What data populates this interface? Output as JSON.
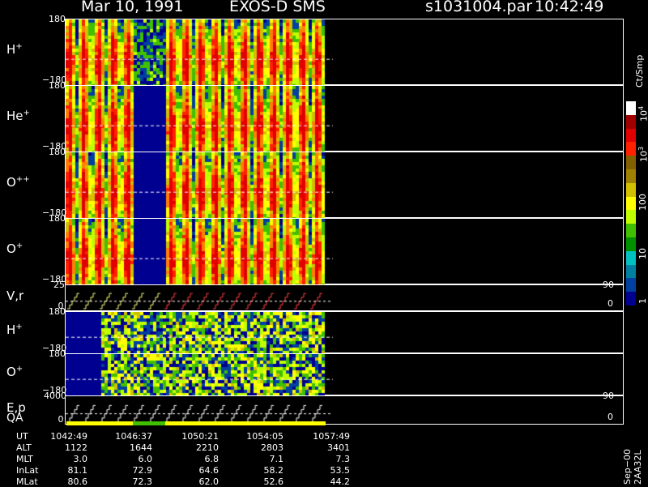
{
  "header": {
    "date": "Mar 10, 1991",
    "instrument": "EXOS-D SMS",
    "file": "s1031004.par",
    "time": "10:42:49"
  },
  "panels": [
    {
      "id": "h-plus-1",
      "label_base": "H",
      "label_sup": "+",
      "ytop": "180",
      "ybot": "−180"
    },
    {
      "id": "he-plus",
      "label_base": "He",
      "label_sup": "+",
      "ytop": "180",
      "ybot": "−180"
    },
    {
      "id": "o-plus-plus",
      "label_base": "O",
      "label_sup": "++",
      "ytop": "180",
      "ybot": "−180"
    },
    {
      "id": "o-plus-1",
      "label_base": "O",
      "label_sup": "+",
      "ytop": "180",
      "ybot": "−180"
    },
    {
      "id": "vr",
      "label_base": "V,r",
      "label_sup": "",
      "ytop": "25",
      "ybot": "0",
      "right_top": "90",
      "right_bot": "0"
    },
    {
      "id": "h-plus-2",
      "label_base": "H",
      "label_sup": "+",
      "ytop": "180",
      "ybot": "−180"
    },
    {
      "id": "o-plus-2",
      "label_base": "O",
      "label_sup": "+",
      "ytop": "180",
      "ybot": "−180"
    },
    {
      "id": "ep",
      "label_base": "E,p",
      "label_sup": "",
      "ytop": "4000",
      "ybot": "0",
      "right_top": "90",
      "right_bot": "0"
    }
  ],
  "qa_label": "QA",
  "colorbar": {
    "unit": "Ct/Smp",
    "ticks": [
      {
        "base": "10",
        "sup": "4"
      },
      {
        "base": "10",
        "sup": "3"
      },
      {
        "base": "100",
        "sup": ""
      },
      {
        "base": "10",
        "sup": ""
      },
      {
        "base": "1",
        "sup": ""
      }
    ],
    "colors": [
      "#ffffff",
      "#a00000",
      "#e00000",
      "#ff2000",
      "#806000",
      "#a08000",
      "#d0c000",
      "#ffff00",
      "#c0ff00",
      "#40c000",
      "#009000",
      "#00c0c0",
      "#0080a0",
      "#0040a0",
      "#000090"
    ]
  },
  "orbit_table": {
    "rows": [
      {
        "label": "UT",
        "values": [
          "1042:49",
          "1046:37",
          "1050:21",
          "1054:05",
          "1057:49"
        ]
      },
      {
        "label": "ALT",
        "values": [
          "1122",
          "1644",
          "2210",
          "2803",
          "3401"
        ]
      },
      {
        "label": "MLT",
        "values": [
          "3.0",
          "6.0",
          "6.8",
          "7.1",
          "7.3"
        ]
      },
      {
        "label": "InLat",
        "values": [
          "81.1",
          "72.9",
          "64.6",
          "58.2",
          "53.5"
        ]
      },
      {
        "label": "MLat",
        "values": [
          "80.6",
          "72.3",
          "62.0",
          "52.6",
          "44.2"
        ]
      }
    ]
  },
  "footer": "Sep−00  2AA32L",
  "chart_data": {
    "type": "heatmap",
    "title": "Mar 10, 1991   EXOS-D SMS",
    "x": [
      "1042:49",
      "1046:37",
      "1050:21",
      "1054:05",
      "1057:49"
    ],
    "xlabel": "UT",
    "panels": [
      "H+",
      "He+",
      "O++",
      "O+",
      "V,r",
      "H+",
      "O+",
      "E,p"
    ],
    "ylim_pitch_angle": [
      -180,
      180
    ],
    "colorbar_range": [
      1,
      10000
    ],
    "colorbar_scale": "log"
  }
}
